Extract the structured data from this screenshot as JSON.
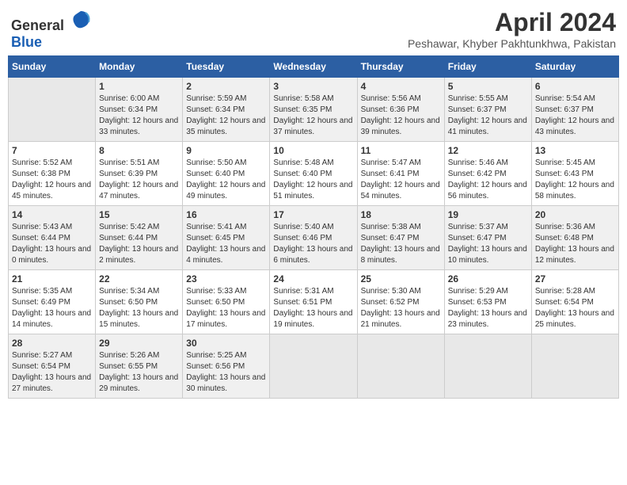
{
  "header": {
    "logo_general": "General",
    "logo_blue": "Blue",
    "month_year": "April 2024",
    "location": "Peshawar, Khyber Pakhtunkhwa, Pakistan"
  },
  "weekdays": [
    "Sunday",
    "Monday",
    "Tuesday",
    "Wednesday",
    "Thursday",
    "Friday",
    "Saturday"
  ],
  "weeks": [
    [
      {
        "day": "",
        "sunrise": "",
        "sunset": "",
        "daylight": "",
        "empty": true
      },
      {
        "day": "1",
        "sunrise": "Sunrise: 6:00 AM",
        "sunset": "Sunset: 6:34 PM",
        "daylight": "Daylight: 12 hours and 33 minutes."
      },
      {
        "day": "2",
        "sunrise": "Sunrise: 5:59 AM",
        "sunset": "Sunset: 6:34 PM",
        "daylight": "Daylight: 12 hours and 35 minutes."
      },
      {
        "day": "3",
        "sunrise": "Sunrise: 5:58 AM",
        "sunset": "Sunset: 6:35 PM",
        "daylight": "Daylight: 12 hours and 37 minutes."
      },
      {
        "day": "4",
        "sunrise": "Sunrise: 5:56 AM",
        "sunset": "Sunset: 6:36 PM",
        "daylight": "Daylight: 12 hours and 39 minutes."
      },
      {
        "day": "5",
        "sunrise": "Sunrise: 5:55 AM",
        "sunset": "Sunset: 6:37 PM",
        "daylight": "Daylight: 12 hours and 41 minutes."
      },
      {
        "day": "6",
        "sunrise": "Sunrise: 5:54 AM",
        "sunset": "Sunset: 6:37 PM",
        "daylight": "Daylight: 12 hours and 43 minutes."
      }
    ],
    [
      {
        "day": "7",
        "sunrise": "Sunrise: 5:52 AM",
        "sunset": "Sunset: 6:38 PM",
        "daylight": "Daylight: 12 hours and 45 minutes."
      },
      {
        "day": "8",
        "sunrise": "Sunrise: 5:51 AM",
        "sunset": "Sunset: 6:39 PM",
        "daylight": "Daylight: 12 hours and 47 minutes."
      },
      {
        "day": "9",
        "sunrise": "Sunrise: 5:50 AM",
        "sunset": "Sunset: 6:40 PM",
        "daylight": "Daylight: 12 hours and 49 minutes."
      },
      {
        "day": "10",
        "sunrise": "Sunrise: 5:48 AM",
        "sunset": "Sunset: 6:40 PM",
        "daylight": "Daylight: 12 hours and 51 minutes."
      },
      {
        "day": "11",
        "sunrise": "Sunrise: 5:47 AM",
        "sunset": "Sunset: 6:41 PM",
        "daylight": "Daylight: 12 hours and 54 minutes."
      },
      {
        "day": "12",
        "sunrise": "Sunrise: 5:46 AM",
        "sunset": "Sunset: 6:42 PM",
        "daylight": "Daylight: 12 hours and 56 minutes."
      },
      {
        "day": "13",
        "sunrise": "Sunrise: 5:45 AM",
        "sunset": "Sunset: 6:43 PM",
        "daylight": "Daylight: 12 hours and 58 minutes."
      }
    ],
    [
      {
        "day": "14",
        "sunrise": "Sunrise: 5:43 AM",
        "sunset": "Sunset: 6:44 PM",
        "daylight": "Daylight: 13 hours and 0 minutes."
      },
      {
        "day": "15",
        "sunrise": "Sunrise: 5:42 AM",
        "sunset": "Sunset: 6:44 PM",
        "daylight": "Daylight: 13 hours and 2 minutes."
      },
      {
        "day": "16",
        "sunrise": "Sunrise: 5:41 AM",
        "sunset": "Sunset: 6:45 PM",
        "daylight": "Daylight: 13 hours and 4 minutes."
      },
      {
        "day": "17",
        "sunrise": "Sunrise: 5:40 AM",
        "sunset": "Sunset: 6:46 PM",
        "daylight": "Daylight: 13 hours and 6 minutes."
      },
      {
        "day": "18",
        "sunrise": "Sunrise: 5:38 AM",
        "sunset": "Sunset: 6:47 PM",
        "daylight": "Daylight: 13 hours and 8 minutes."
      },
      {
        "day": "19",
        "sunrise": "Sunrise: 5:37 AM",
        "sunset": "Sunset: 6:47 PM",
        "daylight": "Daylight: 13 hours and 10 minutes."
      },
      {
        "day": "20",
        "sunrise": "Sunrise: 5:36 AM",
        "sunset": "Sunset: 6:48 PM",
        "daylight": "Daylight: 13 hours and 12 minutes."
      }
    ],
    [
      {
        "day": "21",
        "sunrise": "Sunrise: 5:35 AM",
        "sunset": "Sunset: 6:49 PM",
        "daylight": "Daylight: 13 hours and 14 minutes."
      },
      {
        "day": "22",
        "sunrise": "Sunrise: 5:34 AM",
        "sunset": "Sunset: 6:50 PM",
        "daylight": "Daylight: 13 hours and 15 minutes."
      },
      {
        "day": "23",
        "sunrise": "Sunrise: 5:33 AM",
        "sunset": "Sunset: 6:50 PM",
        "daylight": "Daylight: 13 hours and 17 minutes."
      },
      {
        "day": "24",
        "sunrise": "Sunrise: 5:31 AM",
        "sunset": "Sunset: 6:51 PM",
        "daylight": "Daylight: 13 hours and 19 minutes."
      },
      {
        "day": "25",
        "sunrise": "Sunrise: 5:30 AM",
        "sunset": "Sunset: 6:52 PM",
        "daylight": "Daylight: 13 hours and 21 minutes."
      },
      {
        "day": "26",
        "sunrise": "Sunrise: 5:29 AM",
        "sunset": "Sunset: 6:53 PM",
        "daylight": "Daylight: 13 hours and 23 minutes."
      },
      {
        "day": "27",
        "sunrise": "Sunrise: 5:28 AM",
        "sunset": "Sunset: 6:54 PM",
        "daylight": "Daylight: 13 hours and 25 minutes."
      }
    ],
    [
      {
        "day": "28",
        "sunrise": "Sunrise: 5:27 AM",
        "sunset": "Sunset: 6:54 PM",
        "daylight": "Daylight: 13 hours and 27 minutes."
      },
      {
        "day": "29",
        "sunrise": "Sunrise: 5:26 AM",
        "sunset": "Sunset: 6:55 PM",
        "daylight": "Daylight: 13 hours and 29 minutes."
      },
      {
        "day": "30",
        "sunrise": "Sunrise: 5:25 AM",
        "sunset": "Sunset: 6:56 PM",
        "daylight": "Daylight: 13 hours and 30 minutes."
      },
      {
        "day": "",
        "sunrise": "",
        "sunset": "",
        "daylight": "",
        "empty": true
      },
      {
        "day": "",
        "sunrise": "",
        "sunset": "",
        "daylight": "",
        "empty": true
      },
      {
        "day": "",
        "sunrise": "",
        "sunset": "",
        "daylight": "",
        "empty": true
      },
      {
        "day": "",
        "sunrise": "",
        "sunset": "",
        "daylight": "",
        "empty": true
      }
    ]
  ]
}
